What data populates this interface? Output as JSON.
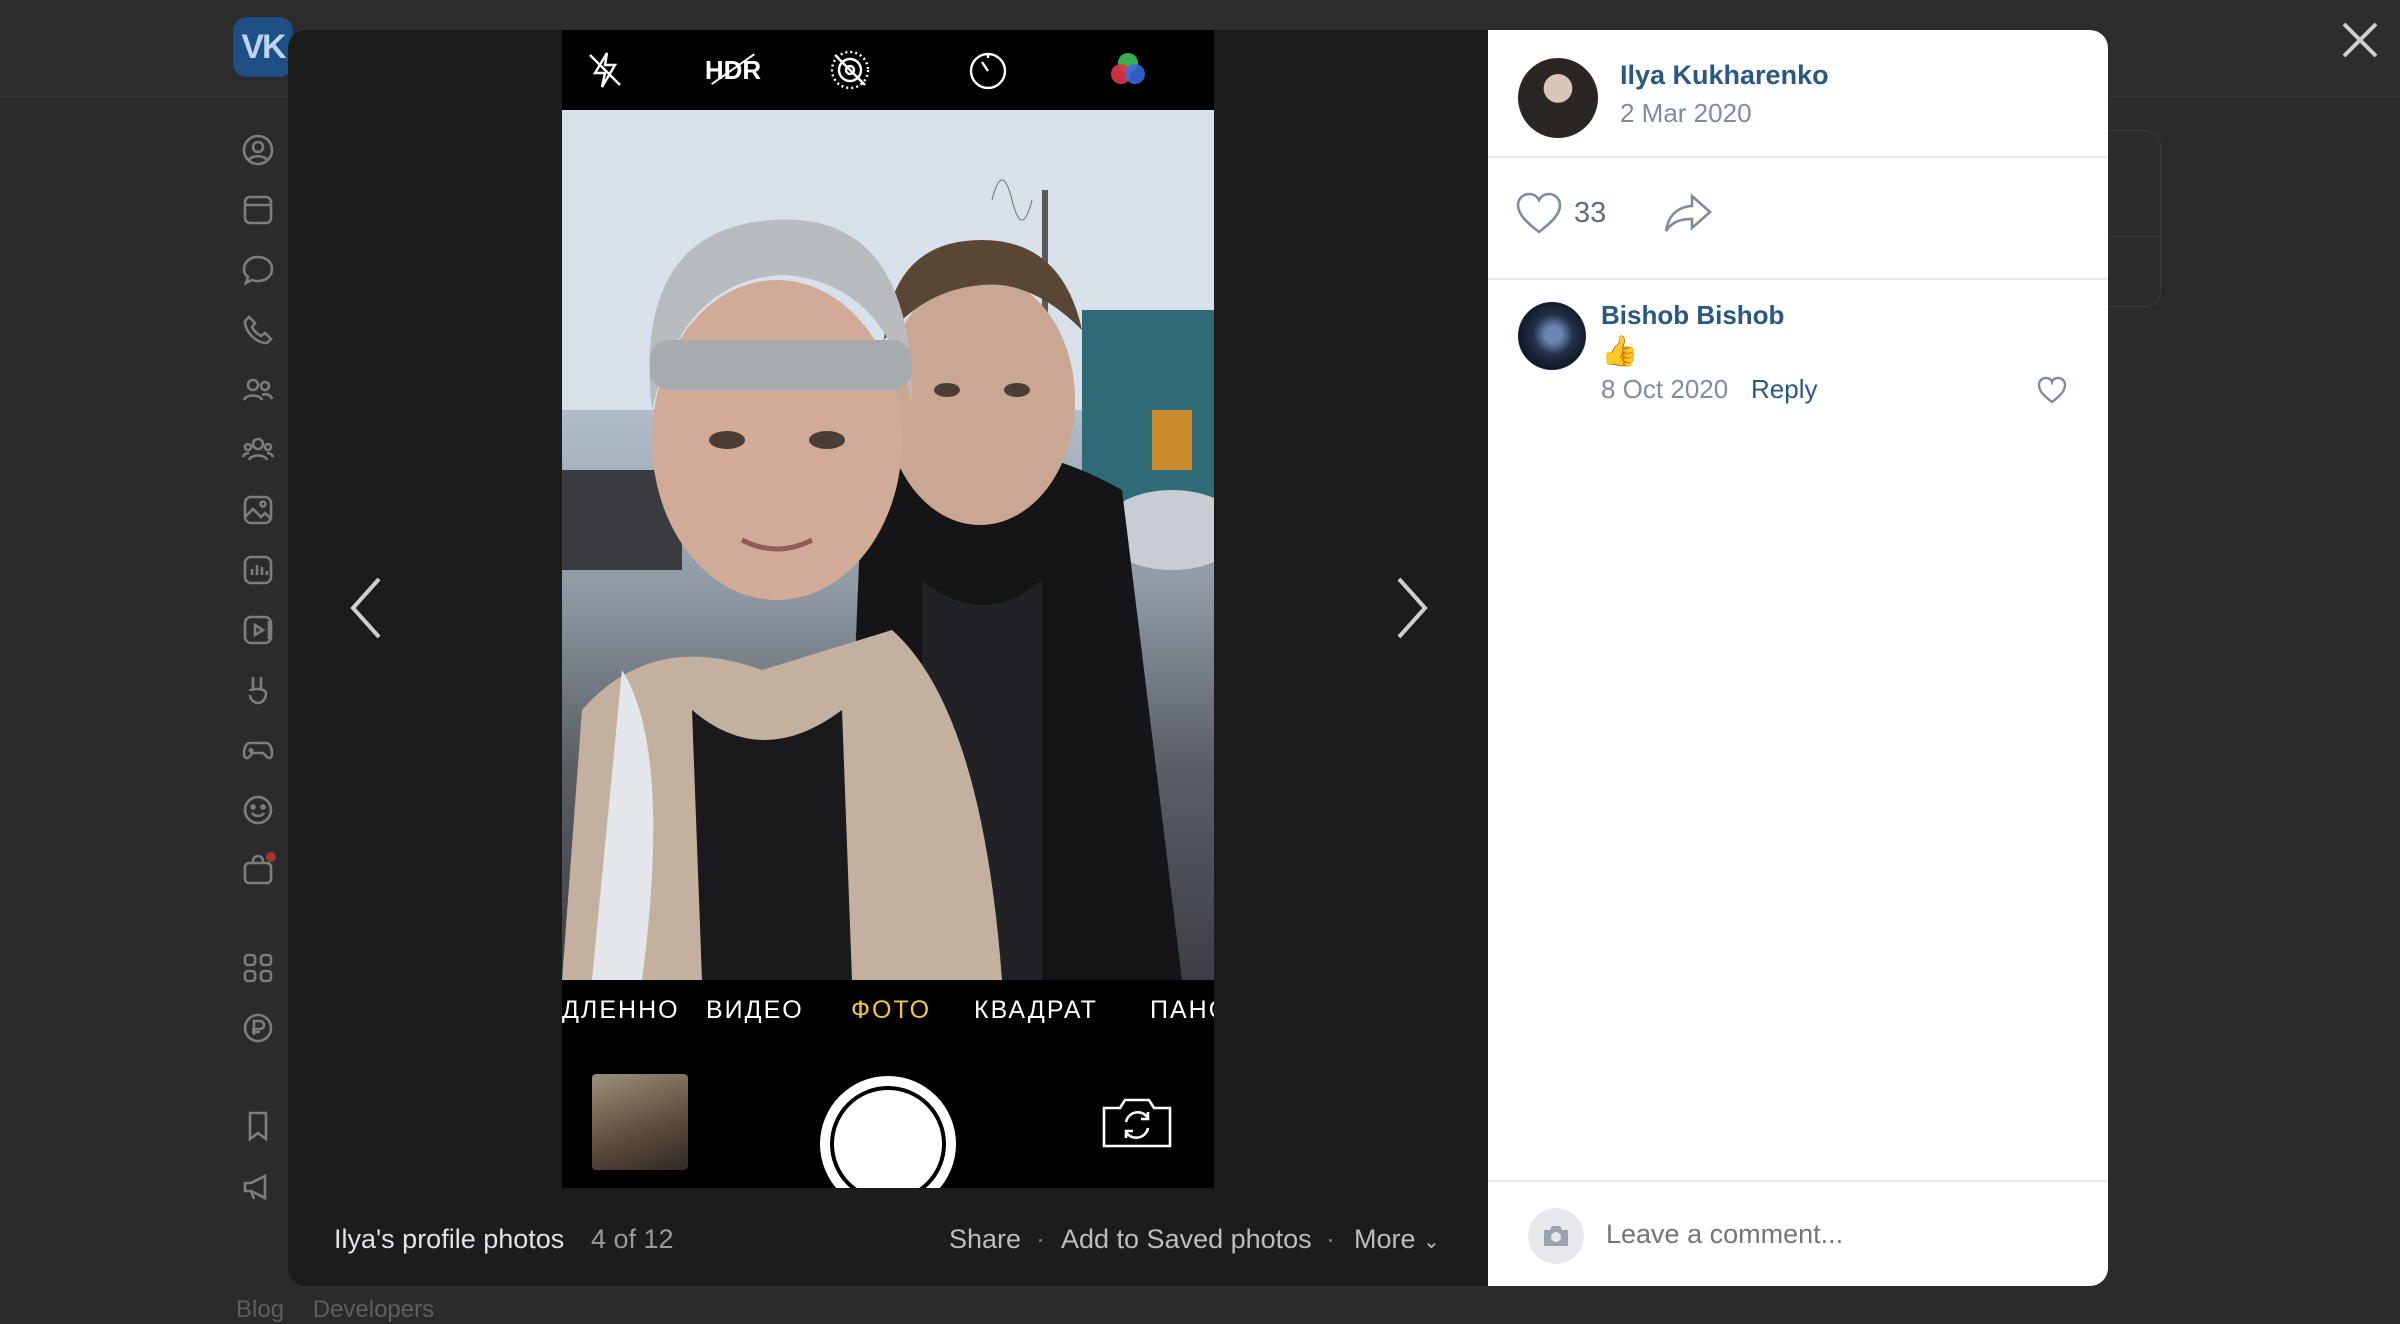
{
  "app": {
    "logo_text": "VK"
  },
  "footer": {
    "links": [
      "Blog",
      "Developers"
    ]
  },
  "photo": {
    "camera_modes": [
      "ДЛЕННО",
      "ВИДЕО",
      "ФОТО",
      "КВАДРАТ",
      "ПАНО"
    ],
    "active_mode": "ФОТО",
    "hdr_label": "HDR"
  },
  "caption": {
    "album": "Ilya's profile photos",
    "counter": "4 of 12",
    "share": "Share",
    "save": "Add to Saved photos",
    "more": "More",
    "separator": "·"
  },
  "author": {
    "name": "Ilya Kukharenko",
    "date": "2 Mar 2020"
  },
  "likes": {
    "count": "33"
  },
  "comments": [
    {
      "name": "Bishob Bishob",
      "text": "👍",
      "date": "8 Oct 2020",
      "reply": "Reply"
    }
  ],
  "composer": {
    "placeholder": "Leave a comment..."
  },
  "colors": {
    "link": "#2a5885",
    "muted": "#818c99",
    "active_mode": "#f6c445",
    "overlay": "#2b2b2b"
  }
}
